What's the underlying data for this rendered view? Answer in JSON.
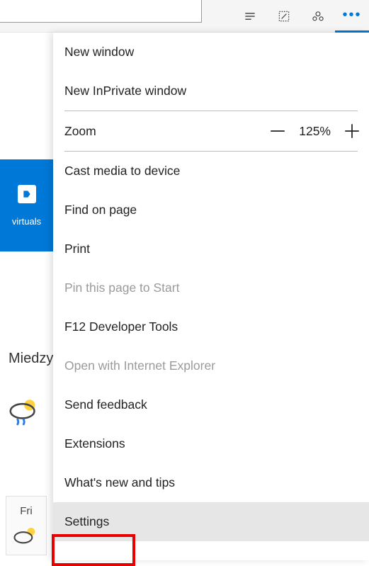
{
  "topbar": {
    "input_edge_visible": true
  },
  "bg": {
    "tile_label": "virtuals",
    "left_text": "Miedzyb",
    "day_label": "Fri"
  },
  "menu": {
    "new_window": "New window",
    "new_inprivate": "New InPrivate window",
    "zoom_label": "Zoom",
    "zoom_value": "125%",
    "cast": "Cast media to device",
    "find": "Find on page",
    "print": "Print",
    "pin": "Pin this page to Start",
    "devtools": "F12 Developer Tools",
    "open_ie": "Open with Internet Explorer",
    "feedback": "Send feedback",
    "extensions": "Extensions",
    "whats_new": "What's new and tips",
    "settings": "Settings"
  }
}
